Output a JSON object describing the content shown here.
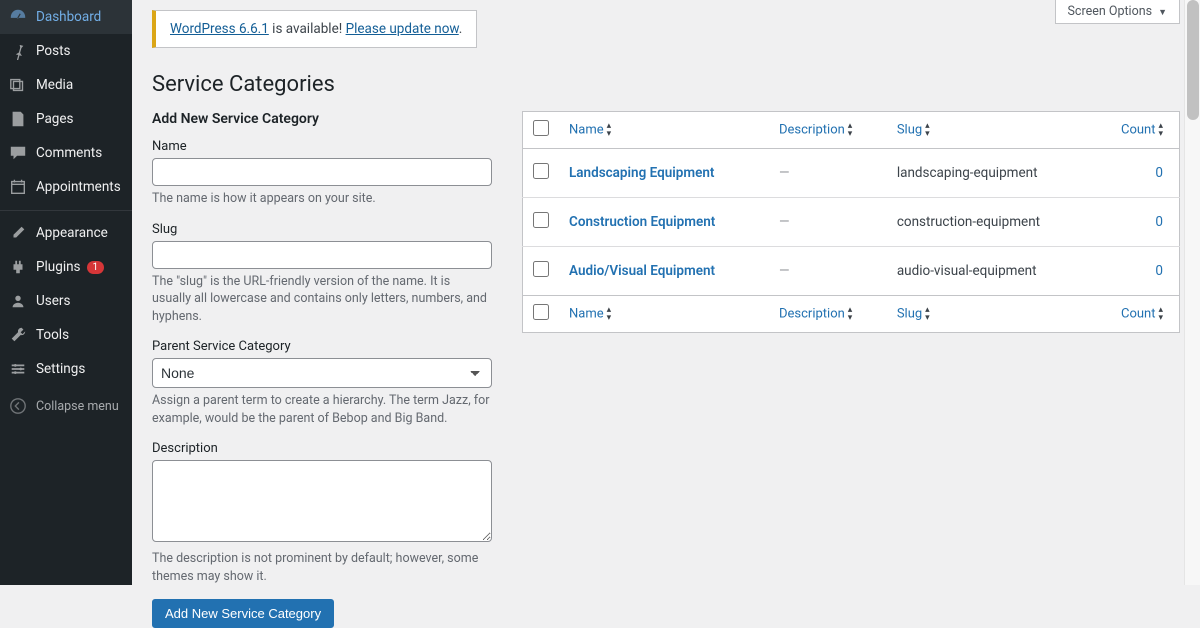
{
  "sidebar": {
    "items": [
      {
        "label": "Dashboard",
        "icon": "dashboard"
      },
      {
        "label": "Posts",
        "icon": "pin"
      },
      {
        "label": "Media",
        "icon": "media"
      },
      {
        "label": "Pages",
        "icon": "pages"
      },
      {
        "label": "Comments",
        "icon": "comments"
      },
      {
        "label": "Appointments",
        "icon": "calendar"
      },
      {
        "label": "Appearance",
        "icon": "appearance",
        "sep": true
      },
      {
        "label": "Plugins",
        "icon": "plugin",
        "badge": "1"
      },
      {
        "label": "Users",
        "icon": "users"
      },
      {
        "label": "Tools",
        "icon": "tools"
      },
      {
        "label": "Settings",
        "icon": "settings"
      }
    ],
    "collapse": "Collapse menu"
  },
  "screen_options": "Screen Options",
  "update": {
    "link1": "WordPress 6.6.1",
    "text": " is available! ",
    "link2": "Please update now",
    "tail": "."
  },
  "page_title": "Service Categories",
  "form": {
    "title": "Add New Service Category",
    "name": {
      "label": "Name",
      "desc": "The name is how it appears on your site."
    },
    "slug": {
      "label": "Slug",
      "desc": "The \"slug\" is the URL-friendly version of the name. It is usually all lowercase and contains only letters, numbers, and hyphens."
    },
    "parent": {
      "label": "Parent Service Category",
      "selected": "None",
      "desc": "Assign a parent term to create a hierarchy. The term Jazz, for example, would be the parent of Bebop and Big Band."
    },
    "description": {
      "label": "Description",
      "desc": "The description is not prominent by default; however, some themes may show it."
    },
    "submit": "Add New Service Category"
  },
  "table": {
    "cols": {
      "name": "Name",
      "description": "Description",
      "slug": "Slug",
      "count": "Count"
    },
    "rows": [
      {
        "name": "Landscaping Equipment",
        "description": "—",
        "slug": "landscaping-equipment",
        "count": "0"
      },
      {
        "name": "Construction Equipment",
        "description": "—",
        "slug": "construction-equipment",
        "count": "0"
      },
      {
        "name": "Audio/Visual Equipment",
        "description": "—",
        "slug": "audio-visual-equipment",
        "count": "0"
      }
    ]
  }
}
